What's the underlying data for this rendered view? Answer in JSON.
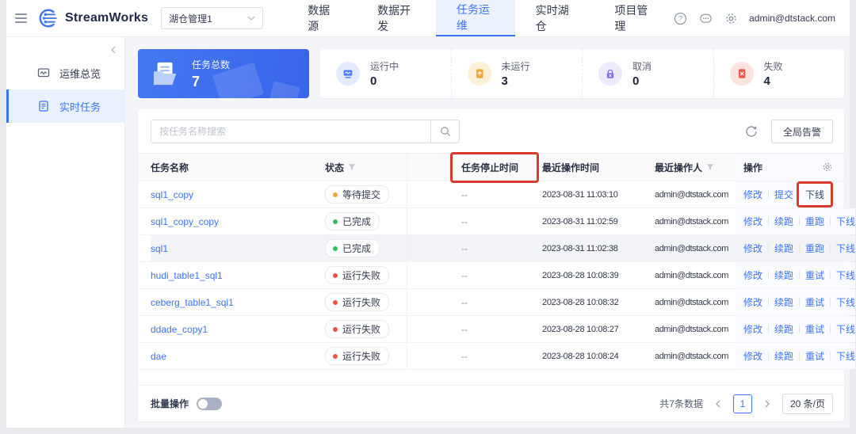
{
  "header": {
    "logo_text": "StreamWorks",
    "workspace": "湖仓管理1",
    "nav": [
      {
        "label": "数据源",
        "active": false
      },
      {
        "label": "数据开发",
        "active": false
      },
      {
        "label": "任务运维",
        "active": true
      },
      {
        "label": "实时湖仓",
        "active": false
      },
      {
        "label": "项目管理",
        "active": false
      }
    ],
    "user_email": "admin@dtstack.com"
  },
  "sidebar": {
    "items": [
      {
        "label": "运维总览",
        "active": false
      },
      {
        "label": "实时任务",
        "active": true
      }
    ]
  },
  "stats": {
    "total": {
      "label": "任务总数",
      "value": "7"
    },
    "cards": [
      {
        "label": "运行中",
        "value": "0",
        "color": "#4d7bf3"
      },
      {
        "label": "未运行",
        "value": "3",
        "color": "#f0a73a"
      },
      {
        "label": "取消",
        "value": "0",
        "color": "#7b6ef6"
      },
      {
        "label": "失败",
        "value": "4",
        "color": "#e25e4e"
      }
    ]
  },
  "toolbar": {
    "search_placeholder": "按任务名称搜索",
    "alarm_label": "全局告警"
  },
  "table": {
    "columns": [
      "任务名称",
      "状态",
      "任务停止时间",
      "最近操作时间",
      "最近操作人",
      "操作"
    ],
    "rows": [
      {
        "name": "sql1_copy",
        "status": "等待提交",
        "status_color": "#f5a43b",
        "stop_time": "--",
        "op_time": "2023-08-31 11:03:10",
        "operator": "admin@dtstack.com",
        "actions": [
          "修改",
          "提交",
          "下线"
        ],
        "annotated_action": "下线"
      },
      {
        "name": "sql1_copy_copy",
        "status": "已完成",
        "status_color": "#2fc25b",
        "stop_time": "--",
        "op_time": "2023-08-31 11:02:59",
        "operator": "admin@dtstack.com",
        "actions": [
          "修改",
          "续跑",
          "重跑",
          "下线"
        ]
      },
      {
        "name": "sql1",
        "status": "已完成",
        "status_color": "#2fc25b",
        "stop_time": "--",
        "op_time": "2023-08-31 11:02:38",
        "operator": "admin@dtstack.com",
        "actions": [
          "修改",
          "续跑",
          "重跑",
          "下线"
        ],
        "highlighted": true
      },
      {
        "name": "hudi_table1_sql1",
        "status": "运行失败",
        "status_color": "#e4574a",
        "stop_time": "--",
        "op_time": "2023-08-28 10:08:39",
        "operator": "admin@dtstack.com",
        "actions": [
          "修改",
          "续跑",
          "重试",
          "下线"
        ]
      },
      {
        "name": "ceberg_table1_sql1",
        "status": "运行失败",
        "status_color": "#e4574a",
        "stop_time": "--",
        "op_time": "2023-08-28 10:08:32",
        "operator": "admin@dtstack.com",
        "actions": [
          "修改",
          "续跑",
          "重试",
          "下线"
        ]
      },
      {
        "name": "ddade_copy1",
        "status": "运行失败",
        "status_color": "#e4574a",
        "stop_time": "--",
        "op_time": "2023-08-28 10:08:27",
        "operator": "admin@dtstack.com",
        "actions": [
          "修改",
          "续跑",
          "重试",
          "下线"
        ]
      },
      {
        "name": "dae",
        "status": "运行失败",
        "status_color": "#e4574a",
        "stop_time": "--",
        "op_time": "2023-08-28 10:08:24",
        "operator": "admin@dtstack.com",
        "actions": [
          "修改",
          "续跑",
          "重试",
          "下线"
        ]
      }
    ]
  },
  "footer": {
    "batch_label": "批量操作",
    "total_text": "共7条数据",
    "page": "1",
    "page_size": "20 条/页"
  },
  "annotations": {
    "box_color": "#d93a2e",
    "column_highlight": "任务停止时间",
    "row_action_highlight": "下线"
  }
}
